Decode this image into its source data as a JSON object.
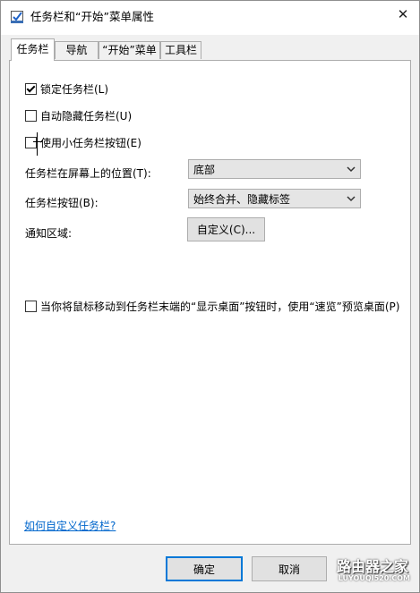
{
  "window": {
    "title": "任务栏和“开始”菜单属性",
    "close_glyph": "✕"
  },
  "tabs": [
    {
      "label": "任务栏",
      "active": true
    },
    {
      "label": "导航",
      "active": false
    },
    {
      "label": "“开始”菜单",
      "active": false
    },
    {
      "label": "工具栏",
      "active": false
    }
  ],
  "checkboxes": {
    "lock_taskbar": {
      "label": "锁定任务栏(L)",
      "checked": true
    },
    "auto_hide": {
      "label": "自动隐藏任务栏(U)",
      "checked": false
    },
    "small_buttons": {
      "label": "使用小任务栏按钮(E)",
      "checked": false
    },
    "peek": {
      "label": "当你将鼠标移动到任务栏末端的“显示桌面”按钮时，使用“速览”预览桌面(P)",
      "checked": false
    }
  },
  "position": {
    "label": "任务栏在屏幕上的位置(T):",
    "value": "底部"
  },
  "buttons_combine": {
    "label": "任务栏按钮(B):",
    "value": "始终合并、隐藏标签"
  },
  "notification": {
    "label": "通知区域:",
    "button_label": "自定义(C)..."
  },
  "help_link": "如何自定义任务栏?",
  "footer": {
    "ok_label": "确定",
    "cancel_label": "取消"
  },
  "watermark": {
    "text": "路由器之家",
    "sub": "LUYOUQI520.COM"
  },
  "colors": {
    "accent": "#0078d7",
    "link": "#0066cc"
  }
}
